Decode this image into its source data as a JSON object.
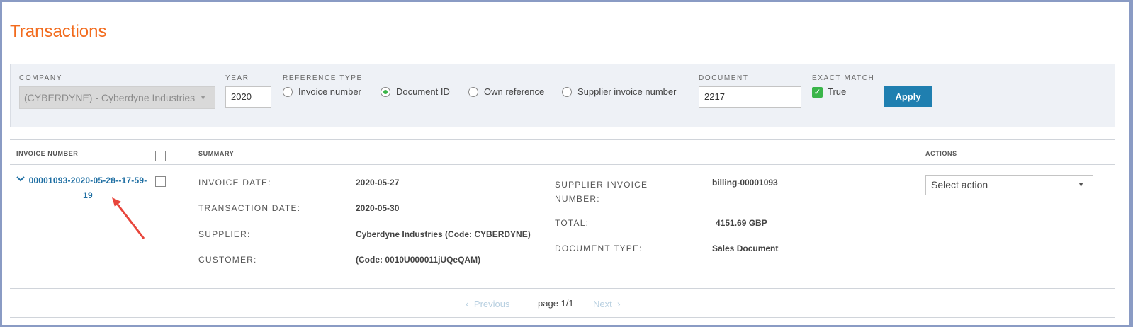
{
  "title": "Transactions",
  "filters": {
    "company_label": "COMPANY",
    "company_value": "(CYBERDYNE) - Cyberdyne Industries",
    "year_label": "YEAR",
    "year_value": "2020",
    "reference_type_label": "REFERENCE TYPE",
    "reference_options": [
      {
        "label": "Invoice number",
        "checked": false
      },
      {
        "label": "Document ID",
        "checked": true
      },
      {
        "label": "Own reference",
        "checked": false
      },
      {
        "label": "Supplier invoice number",
        "checked": false
      }
    ],
    "document_label": "DOCUMENT",
    "document_value": "2217",
    "exact_match_label": "EXACT MATCH",
    "exact_match_value": "True",
    "apply_label": "Apply"
  },
  "table": {
    "headers": {
      "invoice_number": "INVOICE NUMBER",
      "summary": "SUMMARY",
      "actions": "ACTIONS"
    },
    "row": {
      "invoice_number": "00001093-2020-05-28--17-59-19",
      "fields_left": [
        {
          "key": "INVOICE DATE:",
          "value": "2020-05-27"
        },
        {
          "key": "TRANSACTION DATE:",
          "value": "2020-05-30"
        },
        {
          "key": "SUPPLIER:",
          "value": "Cyberdyne Industries (Code: CYBERDYNE)"
        },
        {
          "key": "CUSTOMER:",
          "value": "(Code: 0010U000011jUQeQAM)"
        }
      ],
      "supplier_invoice_number_key": "SUPPLIER INVOICE NUMBER:",
      "supplier_invoice_number_value": "billing-00001093",
      "total_key": "TOTAL:",
      "total_value": "4151.69 GBP",
      "document_type_key": "DOCUMENT TYPE:",
      "document_type_value": "Sales Document",
      "action_placeholder": "Select action"
    }
  },
  "pagination": {
    "previous": "Previous",
    "page": "page 1/1",
    "next": "Next"
  },
  "colors": {
    "title": "#f26b1d",
    "link": "#1f6fa3",
    "apply": "#1f7fb0",
    "check": "#3ab549",
    "arrow": "#e8463c"
  }
}
